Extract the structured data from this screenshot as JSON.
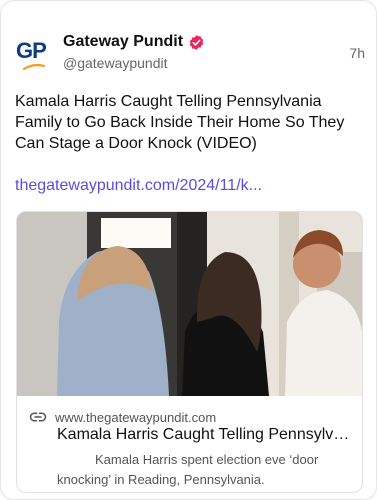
{
  "post": {
    "display_name": "Gateway Pundit",
    "handle": "@gatewaypundit",
    "time": "7h",
    "avatar_text": "GP",
    "text": "Kamala Harris Caught Telling Pennsylvania Family to Go Back Inside Their Home So They Can Stage a Door Knock (VIDEO)",
    "link": "thegatewaypundit.com/2024/11/k..."
  },
  "link_card": {
    "domain": "www.thegatewaypundit.com",
    "title": "Kamala Harris Caught Telling Pennsylvania Family to Go Back Inside Their Home So They Can Stage a Door Knock (VIDEO)",
    "description": "Kamala Harris spent election eve ‘door knocking’ in Reading, Pennsylvania."
  },
  "icons": {
    "verified": "verified-badge-icon",
    "link": "link-icon"
  },
  "colors": {
    "brand": "#0e3c84",
    "accent_orange": "#f39c1f",
    "verified": "#e8265e",
    "link": "#5a4ddb",
    "muted": "#666666"
  }
}
